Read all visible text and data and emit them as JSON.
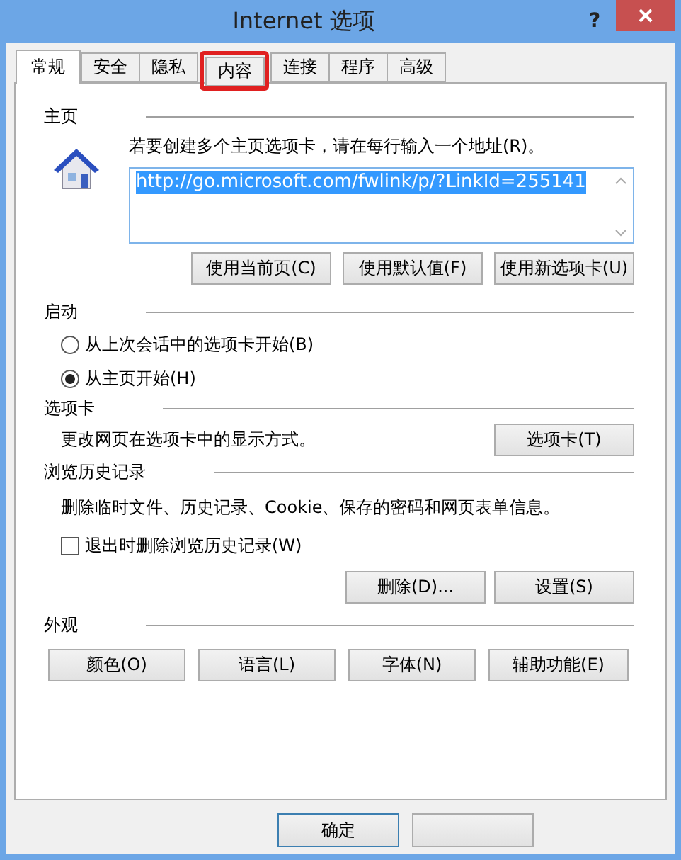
{
  "window": {
    "title": "Internet 选项",
    "help": "?"
  },
  "tabs": [
    {
      "label": "常规",
      "selected": true,
      "highlighted": false
    },
    {
      "label": "安全",
      "selected": false,
      "highlighted": false
    },
    {
      "label": "隐私",
      "selected": false,
      "highlighted": false
    },
    {
      "label": "内容",
      "selected": false,
      "highlighted": true
    },
    {
      "label": "连接",
      "selected": false,
      "highlighted": false
    },
    {
      "label": "程序",
      "selected": false,
      "highlighted": false
    },
    {
      "label": "高级",
      "selected": false,
      "highlighted": false
    }
  ],
  "home_page": {
    "heading": "主页",
    "instruction": "若要创建多个主页选项卡，请在每行输入一个地址(R)。",
    "url": "http://go.microsoft.com/fwlink/p/?LinkId=255141",
    "url_selected": true,
    "buttons": [
      "使用当前页(C)",
      "使用默认值(F)",
      "使用新选项卡(U)"
    ]
  },
  "startup": {
    "heading": "启动",
    "options": [
      {
        "label": "从上次会话中的选项卡开始(B)",
        "selected": false
      },
      {
        "label": "从主页开始(H)",
        "selected": true
      }
    ]
  },
  "tabs_section": {
    "heading": "选项卡",
    "description": "更改网页在选项卡中的显示方式。",
    "button": "选项卡(T)"
  },
  "history": {
    "heading": "浏览历史记录",
    "description": "删除临时文件、历史记录、Cookie、保存的密码和网页表单信息。",
    "checkbox": {
      "label": "退出时删除浏览历史记录(W)",
      "checked": false
    },
    "buttons": [
      "删除(D)...",
      "设置(S)"
    ]
  },
  "appearance": {
    "heading": "外观",
    "buttons": [
      "颜色(O)",
      "语言(L)",
      "字体(N)",
      "辅助功能(E)"
    ]
  },
  "footer_buttons": [
    {
      "kind": "labeled",
      "label": "确定"
    },
    {
      "kind": "blank"
    }
  ]
}
